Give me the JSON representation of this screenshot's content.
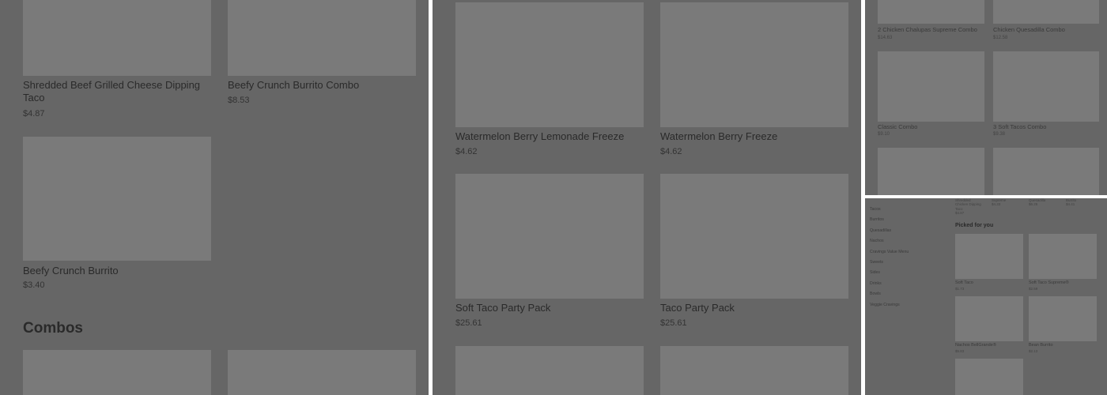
{
  "panel_main": {
    "items": [
      {
        "title": "Shredded Beef Grilled Cheese Dipping Taco",
        "price": "$4.87"
      },
      {
        "title": "Beefy Crunch Burrito Combo",
        "price": "$8.53"
      },
      {
        "title": "Beefy Crunch Burrito",
        "price": "$3.40"
      }
    ],
    "section_title": "Combos"
  },
  "panel_drinks": {
    "items": [
      {
        "title": "Watermelon Berry Lemonade Freeze",
        "price": "$4.62"
      },
      {
        "title": "Watermelon Berry Freeze",
        "price": "$4.62"
      },
      {
        "title": "Soft Taco Party Pack",
        "price": "$25.61"
      },
      {
        "title": "Taco Party Pack",
        "price": "$25.61"
      }
    ]
  },
  "panel_combos": {
    "items": [
      {
        "title": "2 Chicken Chalupas Supreme Combo",
        "price": "$14.63"
      },
      {
        "title": "Chicken Quesadilla Combo",
        "price": "$12.58"
      },
      {
        "title": "Classic Combo",
        "price": "$9.10"
      },
      {
        "title": "3 Soft Tacos Combo",
        "price": "$9.38"
      }
    ]
  },
  "panel_menu": {
    "top_items": [
      {
        "title": "Shredded Chicken Dipping Taco",
        "price": "$4.87"
      },
      {
        "title": "Supreme",
        "price": "$4.33"
      },
      {
        "title": "Quesadilla",
        "price": "$6.25"
      },
      {
        "title": "Burrito",
        "price": "$4.41"
      }
    ],
    "categories": [
      "Tacos",
      "Burritos",
      "Quesadillas",
      "Nachos",
      "Cravings Value Menu",
      "Sweets",
      "Sides",
      "Drinks",
      "Bowls",
      "Veggie Cravings"
    ],
    "picked_heading": "Picked for you",
    "picked_items": [
      {
        "title": "Soft Taco",
        "price": "$1.73"
      },
      {
        "title": "Soft Taco Supreme®",
        "price": "$2.59"
      },
      {
        "title": "Nachos BellGrande®",
        "price": "$5.83"
      },
      {
        "title": "Bean Burrito",
        "price": "$2.13"
      }
    ]
  }
}
